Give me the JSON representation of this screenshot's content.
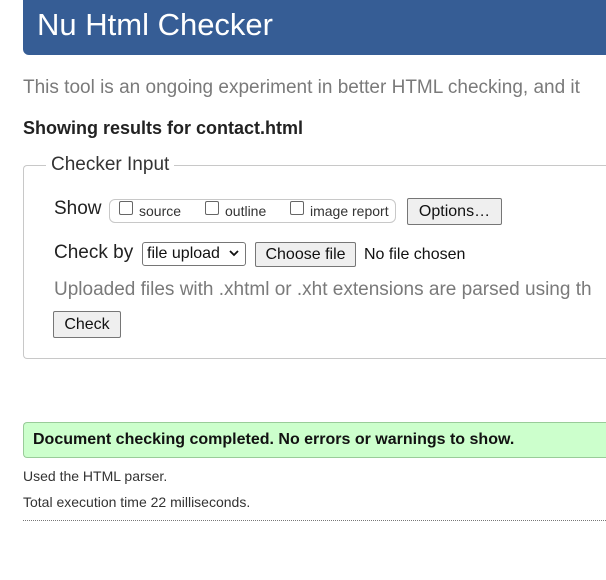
{
  "header": {
    "title": "Nu Html Checker"
  },
  "intro": {
    "text": "This tool is an ongoing experiment in better HTML checking, and it"
  },
  "results": {
    "heading": "Showing results for contact.html"
  },
  "checker_input": {
    "legend": "Checker Input",
    "show_label": "Show",
    "show_options": [
      {
        "label": "source",
        "checked": false
      },
      {
        "label": "outline",
        "checked": false
      },
      {
        "label": "image report",
        "checked": false
      }
    ],
    "options_button": "Options…",
    "check_by_label": "Check by",
    "check_by_selected": "file upload",
    "choose_file_button": "Choose file",
    "file_status": "No file chosen",
    "upload_note": "Uploaded files with .xhtml or .xht extensions are parsed using th",
    "check_button": "Check"
  },
  "status": {
    "message": "Document checking completed. No errors or warnings to show.",
    "success_color": "#ccffcc"
  },
  "info": {
    "parser": "Used the HTML parser.",
    "execution_time": "Total execution time 22 milliseconds."
  },
  "colors": {
    "header_bg": "#365d95",
    "success_bg": "#ccffcc"
  }
}
